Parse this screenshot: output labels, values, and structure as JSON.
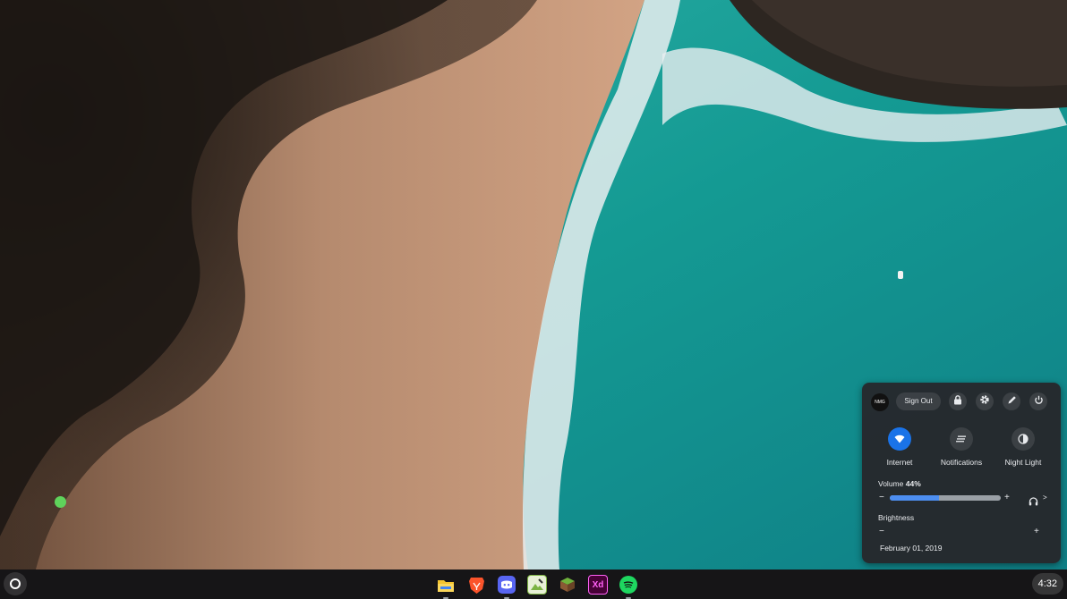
{
  "tray": {
    "avatar_text": "NMG",
    "sign_out_label": "Sign Out",
    "header_icons": [
      "lock-icon",
      "gear-icon",
      "pen-icon",
      "power-icon"
    ],
    "features": [
      {
        "label": "Internet",
        "icon": "wifi-icon",
        "active": true
      },
      {
        "label": "Notifications",
        "icon": "notifications-icon",
        "active": false
      },
      {
        "label": "Night Light",
        "icon": "night-light-icon",
        "active": false
      }
    ],
    "volume": {
      "label": "Volume",
      "percent_text": "44%",
      "level": 0.44,
      "minus": "−",
      "plus": "+",
      "output_icon": "headphones-icon",
      "more": ">"
    },
    "brightness": {
      "label": "Brightness",
      "minus": "−",
      "plus": "+"
    },
    "date": "February 01, 2019"
  },
  "shelf": {
    "launcher_icon": "launcher-icon",
    "apps": [
      {
        "name": "files",
        "icon": "folder-icon",
        "color": "#f4c430"
      },
      {
        "name": "brave",
        "icon": "brave-lion-icon",
        "color": "#fb542b"
      },
      {
        "name": "discord",
        "icon": "discord-icon",
        "color": "#5865f2"
      },
      {
        "name": "image-editor",
        "icon": "image-editor-icon",
        "color": "#7cb342"
      },
      {
        "name": "minecraft",
        "icon": "grass-block-icon",
        "color": "#5d8c2c"
      },
      {
        "name": "adobe-xd",
        "icon": "adobe-xd-icon",
        "color": "#470137",
        "text": "Xd"
      },
      {
        "name": "spotify",
        "icon": "spotify-icon",
        "color": "#1ed760"
      }
    ],
    "clock": "4:32"
  },
  "colors": {
    "accent": "#1a73e8",
    "cursor": "#5fd35b"
  }
}
